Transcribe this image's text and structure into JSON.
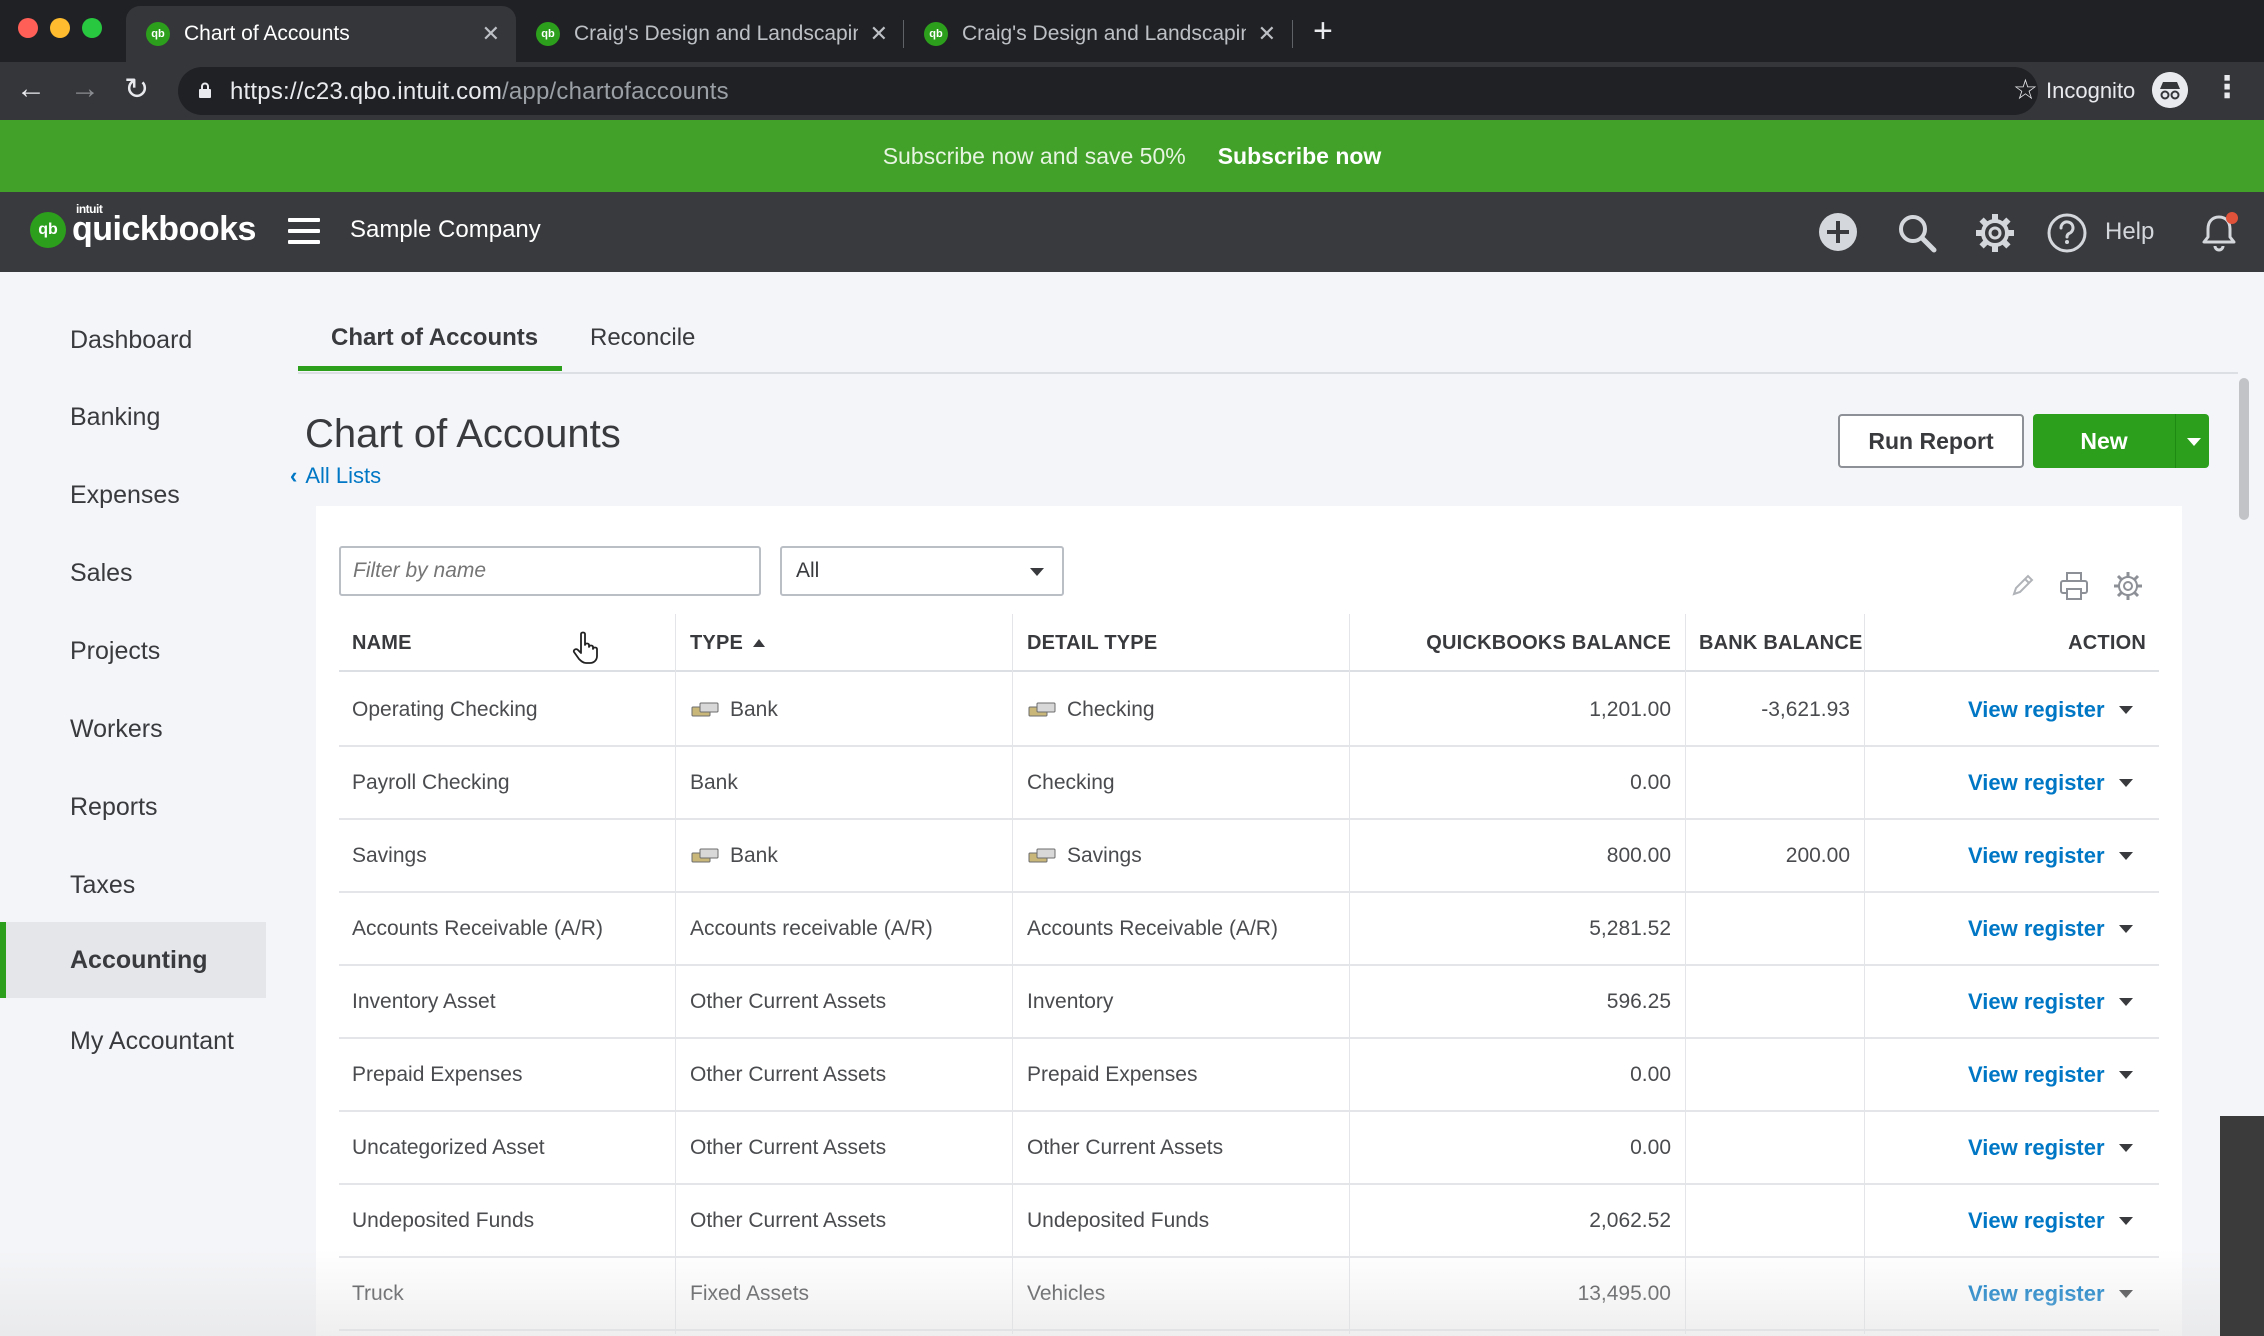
{
  "browser": {
    "tabs": [
      {
        "title": "Chart of Accounts",
        "active": true
      },
      {
        "title": "Craig's Design and Landscaping",
        "active": false
      },
      {
        "title": "Craig's Design and Landscaping",
        "active": false
      }
    ],
    "url_host": "https://c23.qbo.intuit.com",
    "url_path": "/app/chartofaccounts",
    "incognito_label": "Incognito",
    "favicon_text": "qb"
  },
  "promo": {
    "text": "Subscribe now and save 50%",
    "link": "Subscribe now",
    "color": "#41a128"
  },
  "appbar": {
    "logo_small": "intuit",
    "logo_word": "quickbooks",
    "logo_mark": "qb",
    "company": "Sample Company",
    "help_label": "Help"
  },
  "sidebar": {
    "items": [
      {
        "label": "Dashboard",
        "active": false
      },
      {
        "label": "Banking",
        "active": false
      },
      {
        "label": "Expenses",
        "active": false
      },
      {
        "label": "Sales",
        "active": false
      },
      {
        "label": "Projects",
        "active": false
      },
      {
        "label": "Workers",
        "active": false
      },
      {
        "label": "Reports",
        "active": false
      },
      {
        "label": "Taxes",
        "active": false
      },
      {
        "label": "Accounting",
        "active": true
      },
      {
        "label": "My Accountant",
        "active": false
      }
    ]
  },
  "page": {
    "tabs": [
      "Chart of Accounts",
      "Reconcile"
    ],
    "title": "Chart of Accounts",
    "back_link": "All Lists",
    "run_report": "Run Report",
    "new_button": "New",
    "filter_placeholder": "Filter by name",
    "type_filter": "All",
    "accent": "#2ca01c",
    "link_color": "#0077c5"
  },
  "table": {
    "columns": [
      "NAME",
      "TYPE",
      "DETAIL TYPE",
      "QUICKBOOKS BALANCE",
      "BANK BALANCE",
      "ACTION"
    ],
    "sorted_column": "TYPE",
    "sort_direction": "ascending",
    "action_label": "View register",
    "rows": [
      {
        "name": "Operating Checking",
        "type": "Bank",
        "detail": "Checking",
        "qb_balance": "1,201.00",
        "bank_balance": "-3,621.93",
        "bank_icon": true
      },
      {
        "name": "Payroll Checking",
        "type": "Bank",
        "detail": "Checking",
        "qb_balance": "0.00",
        "bank_balance": "",
        "bank_icon": false
      },
      {
        "name": "Savings",
        "type": "Bank",
        "detail": "Savings",
        "qb_balance": "800.00",
        "bank_balance": "200.00",
        "bank_icon": true
      },
      {
        "name": "Accounts Receivable (A/R)",
        "type": "Accounts receivable (A/R)",
        "detail": "Accounts Receivable (A/R)",
        "qb_balance": "5,281.52",
        "bank_balance": "",
        "bank_icon": false
      },
      {
        "name": "Inventory Asset",
        "type": "Other Current Assets",
        "detail": "Inventory",
        "qb_balance": "596.25",
        "bank_balance": "",
        "bank_icon": false
      },
      {
        "name": "Prepaid Expenses",
        "type": "Other Current Assets",
        "detail": "Prepaid Expenses",
        "qb_balance": "0.00",
        "bank_balance": "",
        "bank_icon": false
      },
      {
        "name": "Uncategorized Asset",
        "type": "Other Current Assets",
        "detail": "Other Current Assets",
        "qb_balance": "0.00",
        "bank_balance": "",
        "bank_icon": false
      },
      {
        "name": "Undeposited Funds",
        "type": "Other Current Assets",
        "detail": "Undeposited Funds",
        "qb_balance": "2,062.52",
        "bank_balance": "",
        "bank_icon": false
      },
      {
        "name": "Truck",
        "type": "Fixed Assets",
        "detail": "Vehicles",
        "qb_balance": "13,495.00",
        "bank_balance": "",
        "bank_icon": false
      }
    ]
  }
}
